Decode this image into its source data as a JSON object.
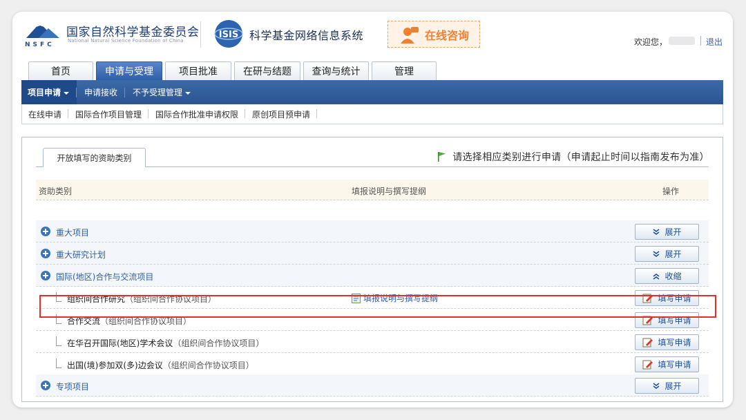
{
  "header": {
    "org_name_cn": "国家自然科学基金委员会",
    "org_name_en": "National Natural Science Foundation of China",
    "org_abbr": "NSFC",
    "system_logo": "ISIS",
    "system_title": "科学基金网络信息系统",
    "consult_label": "在线咨询",
    "welcome": "欢迎您，",
    "logout": "退出"
  },
  "main_tabs": [
    {
      "label": "首页",
      "active": false
    },
    {
      "label": "申请与受理",
      "active": true
    },
    {
      "label": "项目批准",
      "active": false
    },
    {
      "label": "在研与结题",
      "active": false
    },
    {
      "label": "查询与统计",
      "active": false
    },
    {
      "label": "管理",
      "active": false
    }
  ],
  "nav_menu": [
    {
      "label": "项目申请",
      "has_dropdown": true
    },
    {
      "label": "申请接收",
      "has_dropdown": false
    },
    {
      "label": "不予受理管理",
      "has_dropdown": true
    }
  ],
  "sub_menu": [
    "在线申请",
    "国际合作项目管理",
    "国际合作批准申请权限",
    "原创项目预申请"
  ],
  "panel": {
    "tab_label": "开放填写的资助类别",
    "tip": "请选择相应类别进行申请（申请起止时间以指南发布为准）",
    "columns": {
      "category": "资助类别",
      "guide": "填报说明与撰写提纲",
      "action": "操作"
    }
  },
  "rows": [
    {
      "type": "category",
      "label": "重大项目",
      "action": "展开",
      "action_icon": "double-chevron-down-icon"
    },
    {
      "type": "category",
      "label": "重大研究计划",
      "action": "展开",
      "action_icon": "double-chevron-down-icon"
    },
    {
      "type": "category",
      "label": "国际(地区)合作与交流项目",
      "action": "收缩",
      "action_icon": "double-chevron-up-icon"
    },
    {
      "type": "sub",
      "name": "组织间合作研究",
      "note": "（组织间合作协议项目）",
      "guide": "填报说明与撰写提纲",
      "action": "填写申请",
      "action_icon": "edit-pen-icon"
    },
    {
      "type": "sub",
      "name": "合作交流",
      "note": "（组织间合作协议项目）",
      "guide": "",
      "action": "填写申请",
      "action_icon": "edit-pen-icon",
      "highlighted": true
    },
    {
      "type": "sub",
      "name": "在华召开国际(地区)学术会议",
      "note": "（组织间合作协议项目）",
      "guide": "",
      "action": "填写申请",
      "action_icon": "edit-pen-icon"
    },
    {
      "type": "sub",
      "name": "出国(境)参加双(多)边会议",
      "note": "（组织间合作协议项目）",
      "guide": "",
      "action": "填写申请",
      "action_icon": "edit-pen-icon"
    },
    {
      "type": "category",
      "label": "专项项目",
      "action": "展开",
      "action_icon": "double-chevron-down-icon"
    }
  ],
  "colors": {
    "brand_blue": "#2b5491",
    "link_blue": "#2e5fa8",
    "consult_orange": "#f08133",
    "highlight_red": "#e0302c"
  }
}
